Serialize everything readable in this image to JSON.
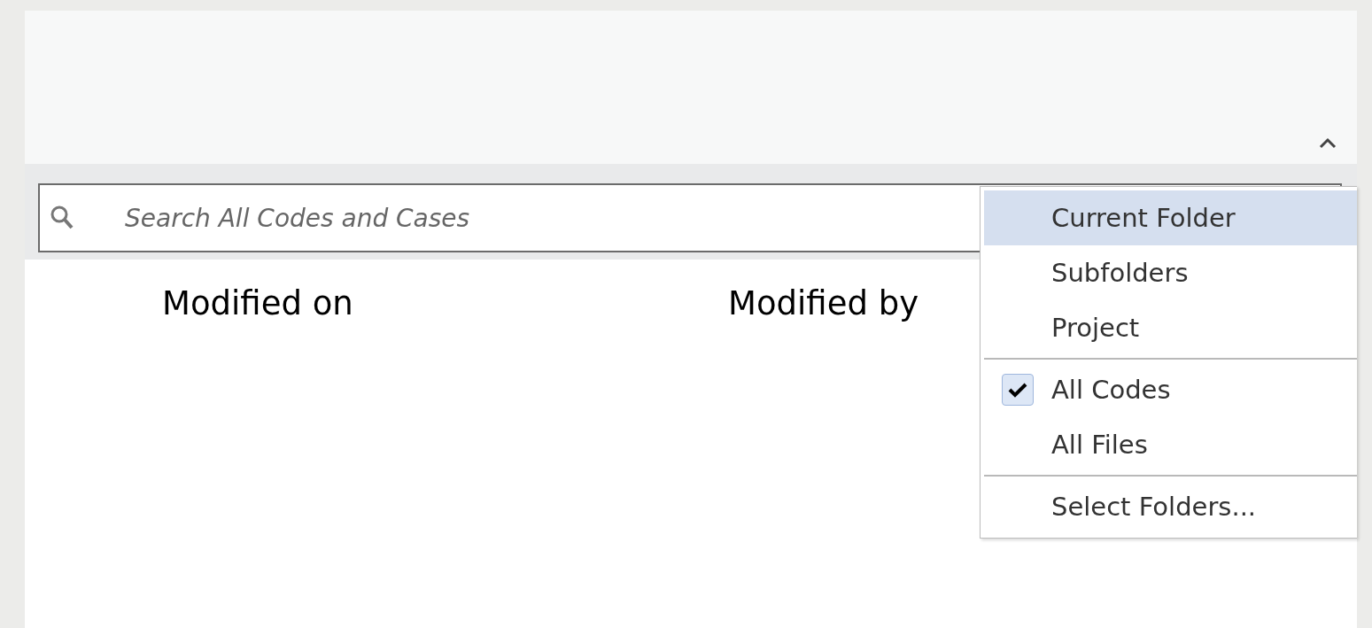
{
  "search": {
    "placeholder": "Search All Codes and Cases"
  },
  "columns": [
    "Modified on",
    "Modified by"
  ],
  "menu": {
    "groups": [
      [
        {
          "label": "Current Folder",
          "highlighted": true,
          "checked": false
        },
        {
          "label": "Subfolders",
          "highlighted": false,
          "checked": false
        },
        {
          "label": "Project",
          "highlighted": false,
          "checked": false
        }
      ],
      [
        {
          "label": "All Codes",
          "highlighted": false,
          "checked": true
        },
        {
          "label": "All Files",
          "highlighted": false,
          "checked": false
        }
      ],
      [
        {
          "label": "Select Folders...",
          "highlighted": false,
          "checked": false
        }
      ]
    ]
  }
}
